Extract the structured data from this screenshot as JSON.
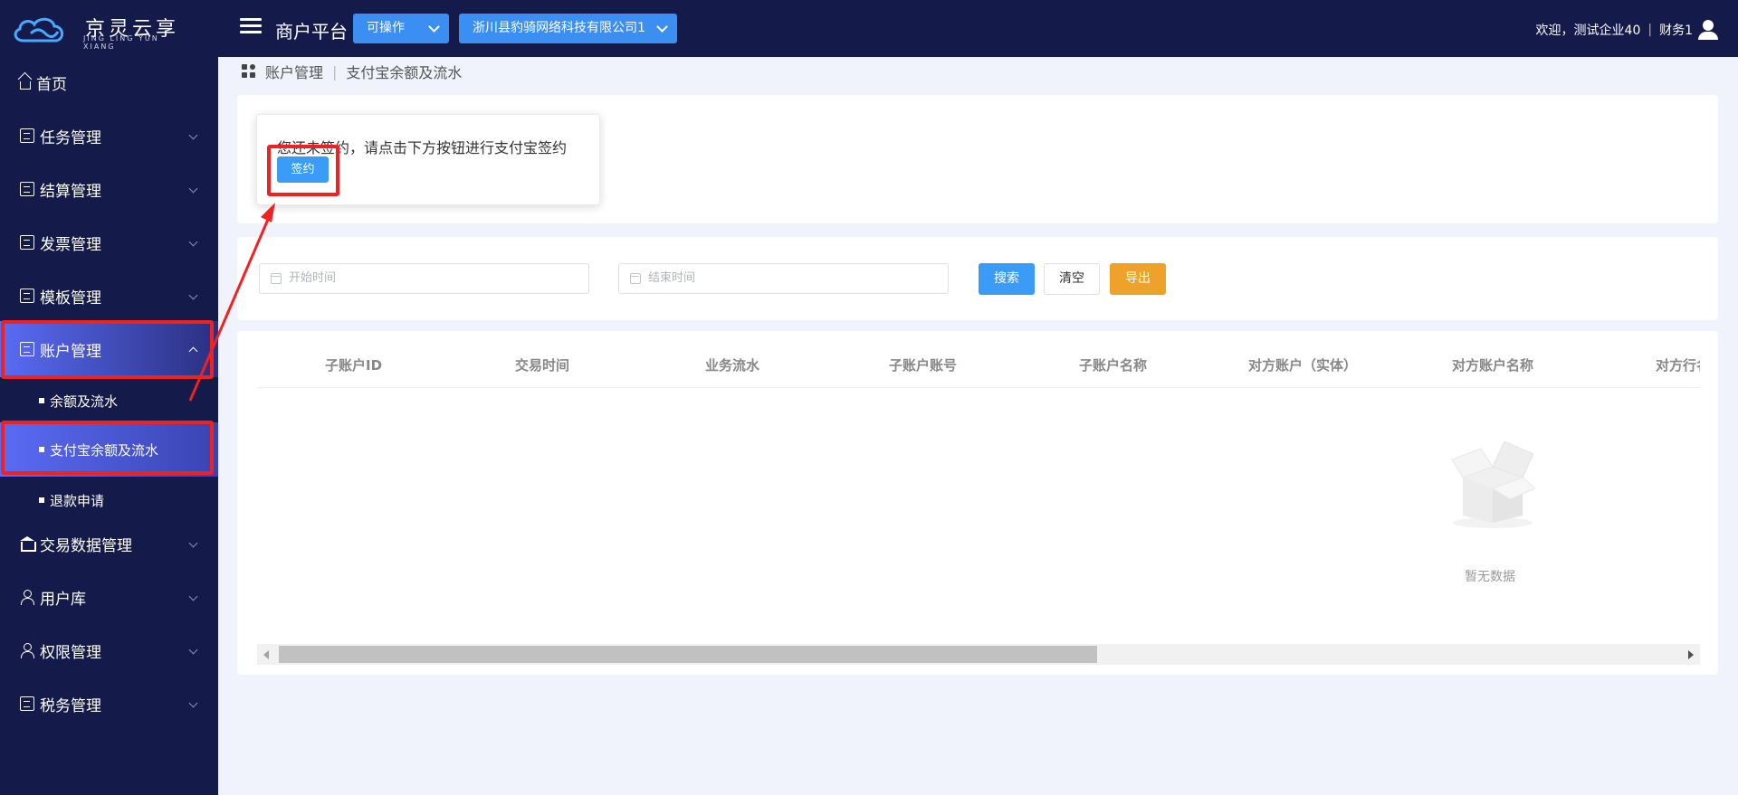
{
  "header": {
    "logo_title": "京灵云享",
    "logo_subtitle": "JING LING YUN XIANG",
    "platform_title": "商户平台",
    "operation_dropdown": "可操作",
    "company_dropdown": "浙川县豹骑网络科技有限公司1",
    "welcome_text": "欢迎，测试企业40",
    "user_role": "财务1"
  },
  "sidebar": {
    "items": [
      {
        "label": "首页",
        "icon": "home-icon"
      },
      {
        "label": "任务管理",
        "icon": "task-icon"
      },
      {
        "label": "结算管理",
        "icon": "settlement-icon"
      },
      {
        "label": "发票管理",
        "icon": "invoice-icon"
      },
      {
        "label": "模板管理",
        "icon": "template-icon"
      },
      {
        "label": "账户管理",
        "icon": "account-icon"
      },
      {
        "label": "交易数据管理",
        "icon": "bank-icon"
      },
      {
        "label": "用户库",
        "icon": "user-icon"
      },
      {
        "label": "权限管理",
        "icon": "permission-icon"
      },
      {
        "label": "税务管理",
        "icon": "tax-icon"
      }
    ],
    "sub_items": [
      {
        "label": "余额及流水"
      },
      {
        "label": "支付宝余额及流水"
      },
      {
        "label": "退款申请"
      }
    ]
  },
  "breadcrumb": {
    "parent": "账户管理",
    "current": "支付宝余额及流水"
  },
  "popover": {
    "message": "您还未签约，请点击下方按钮进行支付宝签约",
    "sign_button": "签约"
  },
  "filters": {
    "start_placeholder": "开始时间",
    "end_placeholder": "结束时间",
    "search_button": "搜索",
    "clear_button": "清空",
    "export_button": "导出"
  },
  "table": {
    "columns": [
      "子账户ID",
      "交易时间",
      "业务流水",
      "子账户账号",
      "子账户名称",
      "对方账户（实体）",
      "对方账户名称",
      "对方行名"
    ],
    "empty_text": "暂无数据"
  },
  "colors": {
    "sidebar_bg": "#141a4a",
    "accent": "#3b9cf7",
    "export": "#eea22a",
    "highlight": "#ee2222"
  }
}
